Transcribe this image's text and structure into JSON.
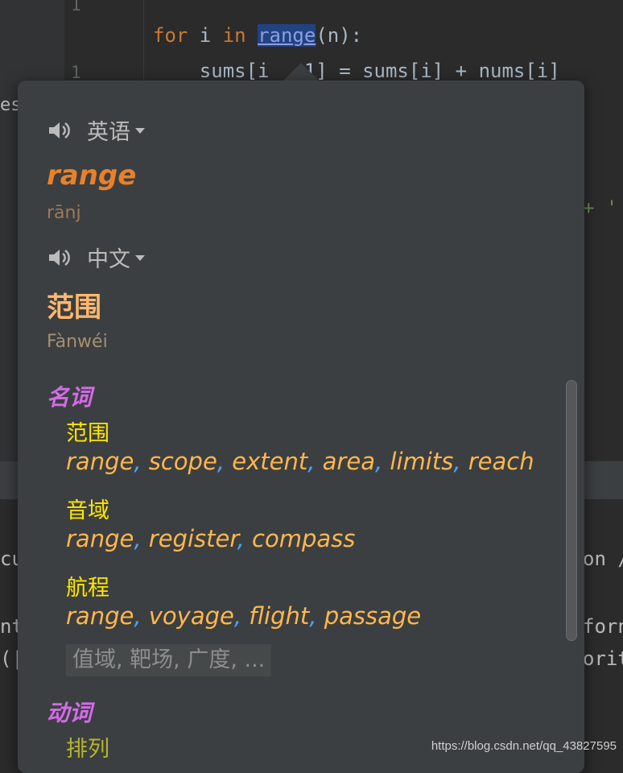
{
  "editor": {
    "line_numbers": [
      "1",
      "1"
    ],
    "code_line_1": {
      "kw_for": "for",
      "var_i": " i ",
      "kw_in": "in",
      "space": " ",
      "fn": "range",
      "rest": "(n):"
    },
    "code_line_2": "    sums[i   1] = sums[i] + nums[i]",
    "fragments": {
      "es": "es",
      "plus": "+ '",
      "cu": "cu",
      "on": "on /",
      "nt": "nt",
      "forn": "forn",
      "paren": "(|",
      "orit": "orit"
    }
  },
  "popup": {
    "source_lang": "英语",
    "target_lang": "中文",
    "word": "range",
    "phonetic": "rānj",
    "translation": "范围",
    "pinyin": "Fànwéi",
    "noun": {
      "pos": "名词",
      "senses": [
        {
          "head": "范围",
          "synonyms": [
            "range",
            "scope",
            "extent",
            "area",
            "limits",
            "reach"
          ]
        },
        {
          "head": "音域",
          "synonyms": [
            "range",
            "register",
            "compass"
          ]
        },
        {
          "head": "航程",
          "synonyms": [
            "range",
            "voyage",
            "flight",
            "passage"
          ]
        }
      ],
      "more": "值域, 靶场, 广度, ..."
    },
    "verb": {
      "pos": "动词",
      "first_head": "排列"
    }
  },
  "watermark": "https://blog.csdn.net/qq_43827595",
  "colors": {
    "word": "#e8812a",
    "translation": "#ffb86c",
    "pos": "#d36be8",
    "sense_head": "#ffe600",
    "synonym": "#ffb74d",
    "separator": "#4aa3ff"
  },
  "icons": [
    "speaker-icon",
    "dropdown-arrow-icon"
  ]
}
